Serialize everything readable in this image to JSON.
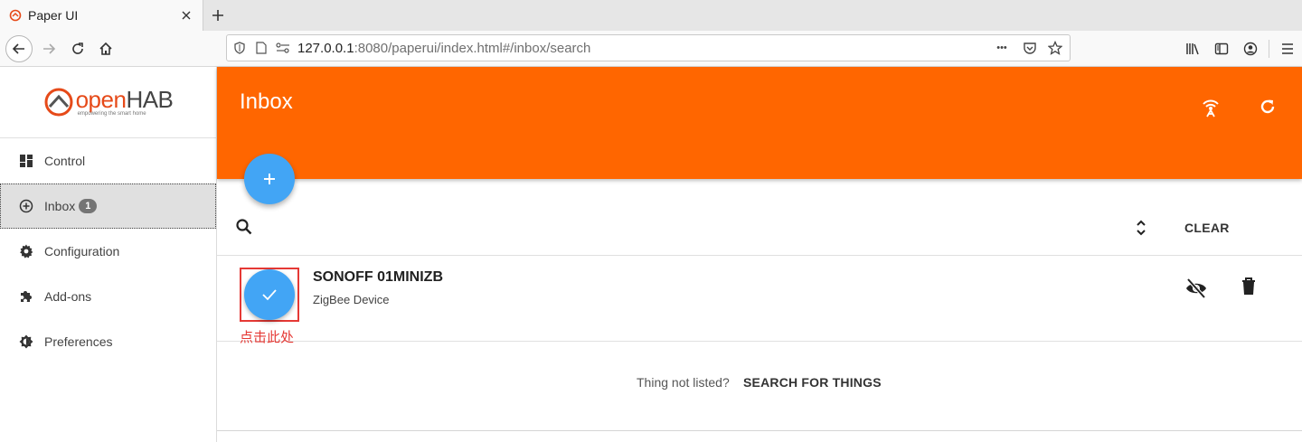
{
  "browser": {
    "tab_title": "Paper UI",
    "url_host": "127.0.0.1",
    "url_rest": ":8080/paperui/index.html#/inbox/search",
    "url_more": "•••"
  },
  "sidebar": {
    "logo_word_orange": "open",
    "logo_word_dark": "HAB",
    "logo_tagline": "empowering the smart home",
    "items": [
      {
        "label": "Control",
        "icon": "dashboard-icon"
      },
      {
        "label": "Inbox",
        "icon": "add-circle-icon",
        "badge": "1"
      },
      {
        "label": "Configuration",
        "icon": "gear-icon"
      },
      {
        "label": "Add-ons",
        "icon": "puzzle-icon"
      },
      {
        "label": "Preferences",
        "icon": "brightness-icon"
      }
    ]
  },
  "header": {
    "title": "Inbox",
    "color": "#ff6600"
  },
  "toolbar": {
    "clear_label": "CLEAR"
  },
  "inbox": {
    "things": [
      {
        "name": "SONOFF 01MINIZB",
        "type": "ZigBee Device"
      }
    ],
    "annotation": "点击此处"
  },
  "footer": {
    "not_listed": "Thing not listed?",
    "search_label": "SEARCH FOR THINGS"
  },
  "colors": {
    "accent_blue": "#42a5f5",
    "annotation_red": "#e53935"
  }
}
